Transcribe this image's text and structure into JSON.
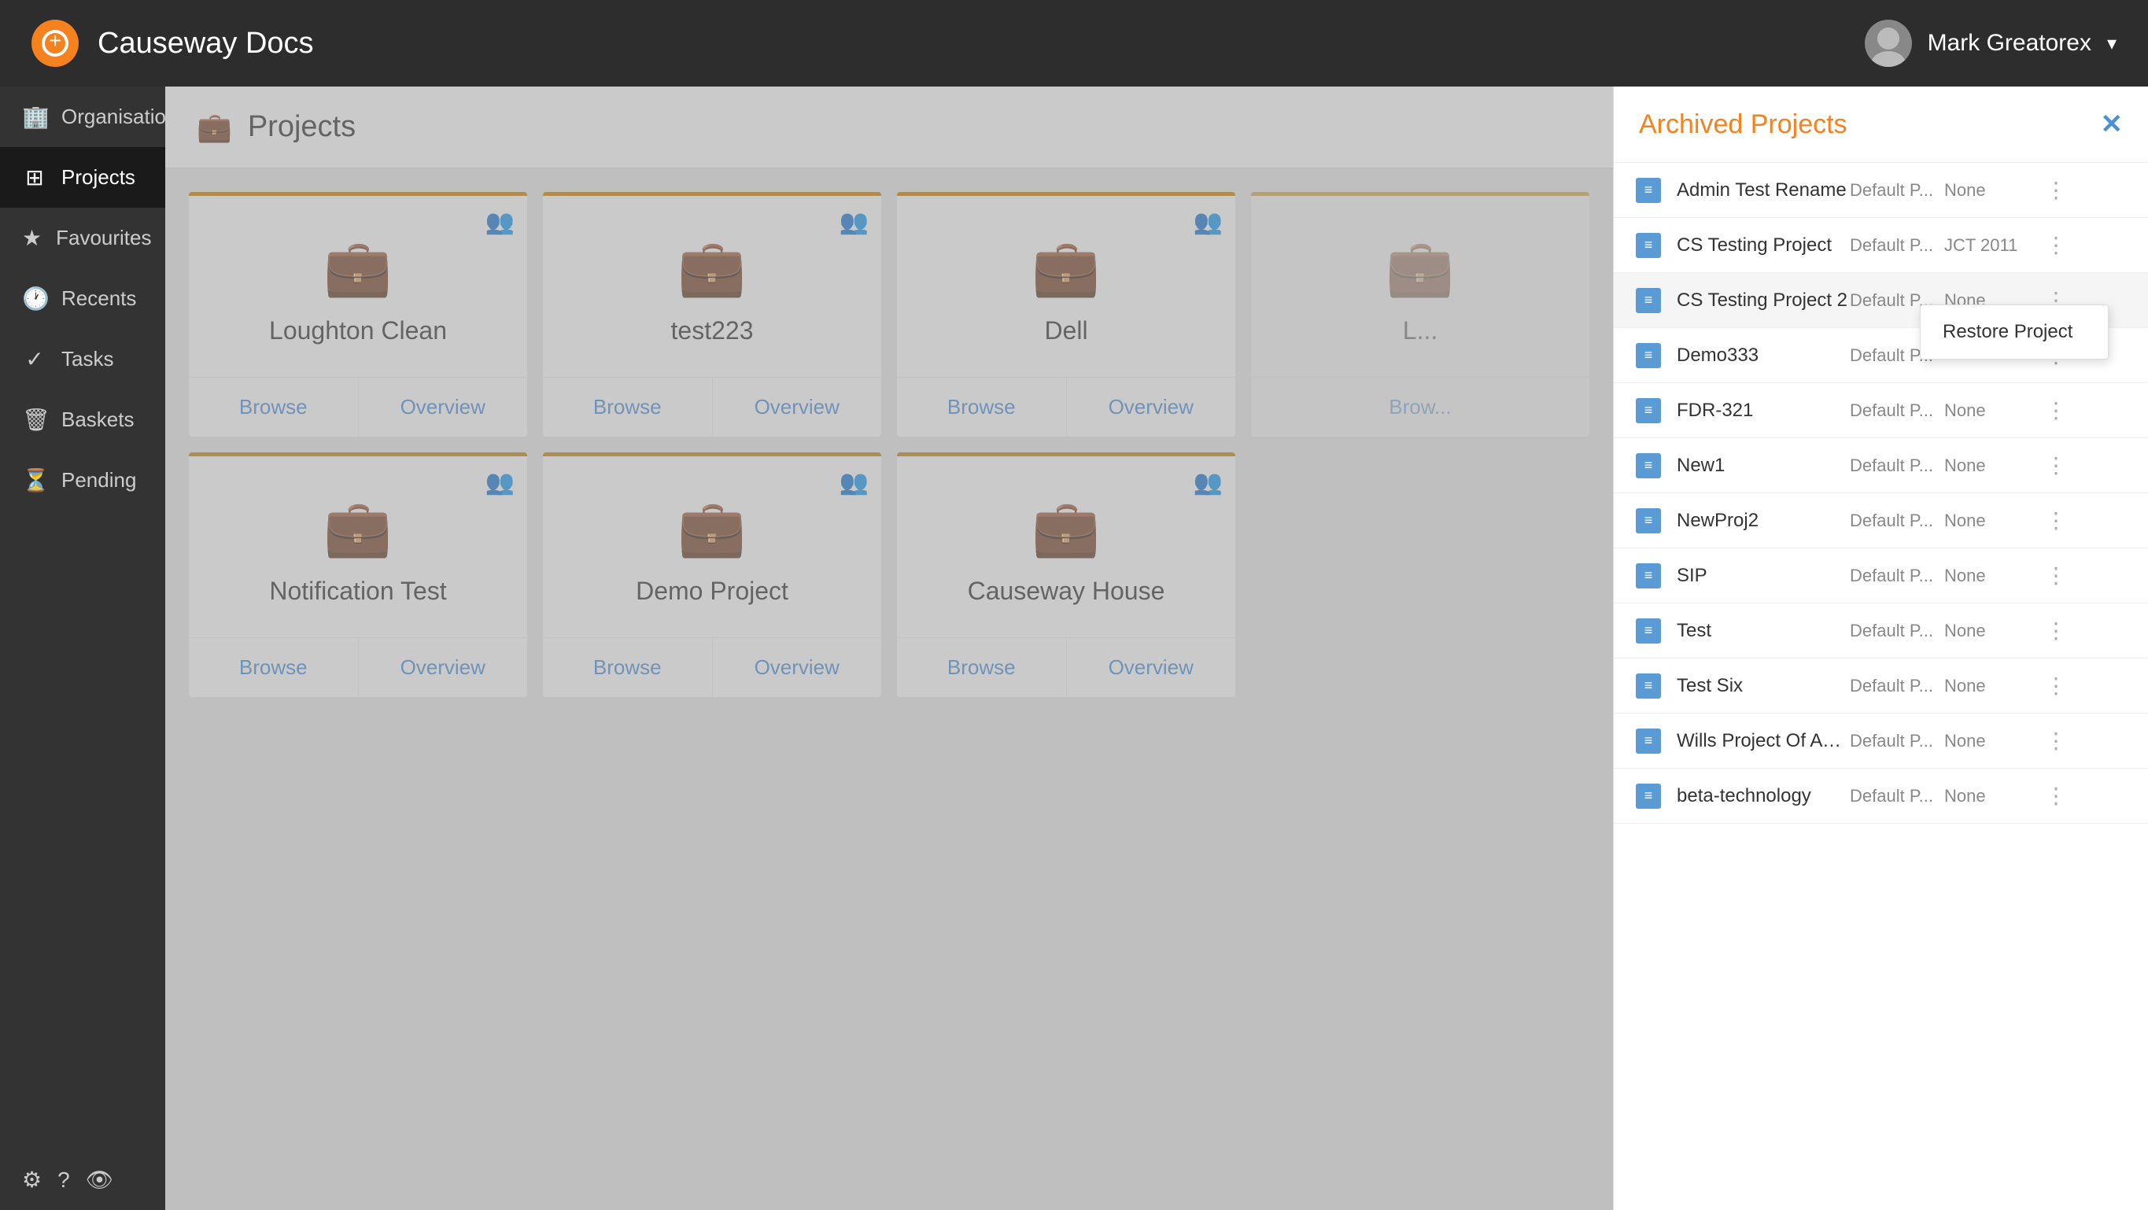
{
  "app": {
    "title": "Causeway Docs",
    "logo_symbol": "+"
  },
  "header": {
    "user_name": "Mark Greatorex",
    "chevron": "▾"
  },
  "sidebar": {
    "items": [
      {
        "id": "organisations",
        "label": "Organisations",
        "icon": "🏢",
        "active": false
      },
      {
        "id": "projects",
        "label": "Projects",
        "icon": "⊞",
        "active": true
      },
      {
        "id": "favourites",
        "label": "Favourites",
        "icon": "★",
        "active": false
      },
      {
        "id": "recents",
        "label": "Recents",
        "icon": "🕐",
        "active": false
      },
      {
        "id": "tasks",
        "label": "Tasks",
        "icon": "✓",
        "active": false
      },
      {
        "id": "baskets",
        "label": "Baskets",
        "icon": "🗑",
        "active": false
      },
      {
        "id": "pending",
        "label": "Pending",
        "icon": "⏳",
        "active": false
      }
    ],
    "bottom_icons": [
      "⚙",
      "?",
      "👁"
    ]
  },
  "projects": {
    "header_title": "Projects",
    "cards": [
      {
        "id": "loughton-clean",
        "title": "Loughton Clean",
        "browse_label": "Browse",
        "overview_label": "Overview"
      },
      {
        "id": "test223",
        "title": "test223",
        "browse_label": "Browse",
        "overview_label": "Overview"
      },
      {
        "id": "dell",
        "title": "Dell",
        "browse_label": "Browse",
        "overview_label": "Overview"
      },
      {
        "id": "fourth",
        "title": "L...",
        "browse_label": "Brow...",
        "overview_label": ""
      },
      {
        "id": "notification-test",
        "title": "Notification Test",
        "browse_label": "Browse",
        "overview_label": "Overview"
      },
      {
        "id": "demo-project",
        "title": "Demo Project",
        "browse_label": "Browse",
        "overview_label": "Overview"
      },
      {
        "id": "causeway-house",
        "title": "Causeway House",
        "browse_label": "Browse",
        "overview_label": "Overview"
      }
    ]
  },
  "archived": {
    "panel_title": "Archived Projects",
    "close_icon": "✕",
    "items": [
      {
        "id": "admin-test-rename",
        "name": "Admin Test Rename",
        "type": "Default P...",
        "contract": "None",
        "show_dropdown": false
      },
      {
        "id": "cs-testing-project",
        "name": "CS Testing Project",
        "type": "Default P...",
        "contract": "JCT 2011",
        "show_dropdown": false
      },
      {
        "id": "cs-testing-project-2",
        "name": "CS Testing Project 2",
        "type": "Default P...",
        "contract": "None",
        "show_dropdown": true
      },
      {
        "id": "demo333",
        "name": "Demo333",
        "type": "Default P...",
        "contract": "",
        "show_dropdown": false
      },
      {
        "id": "fdr-321",
        "name": "FDR-321",
        "type": "Default P...",
        "contract": "None",
        "show_dropdown": false
      },
      {
        "id": "new1",
        "name": "New1",
        "type": "Default P...",
        "contract": "None",
        "show_dropdown": false
      },
      {
        "id": "newproj2",
        "name": "NewProj2",
        "type": "Default P...",
        "contract": "None",
        "show_dropdown": false
      },
      {
        "id": "sip",
        "name": "SIP",
        "type": "Default P...",
        "contract": "None",
        "show_dropdown": false
      },
      {
        "id": "test",
        "name": "Test",
        "type": "Default P...",
        "contract": "None",
        "show_dropdown": false
      },
      {
        "id": "test-six",
        "name": "Test Six",
        "type": "Default P...",
        "contract": "None",
        "show_dropdown": false
      },
      {
        "id": "wills-project",
        "name": "Wills Project Of Awes...",
        "type": "Default P...",
        "contract": "None",
        "show_dropdown": false
      },
      {
        "id": "beta-technology",
        "name": "beta-technology",
        "type": "Default P...",
        "contract": "None",
        "show_dropdown": false
      }
    ],
    "dropdown_label": "Restore Project"
  }
}
